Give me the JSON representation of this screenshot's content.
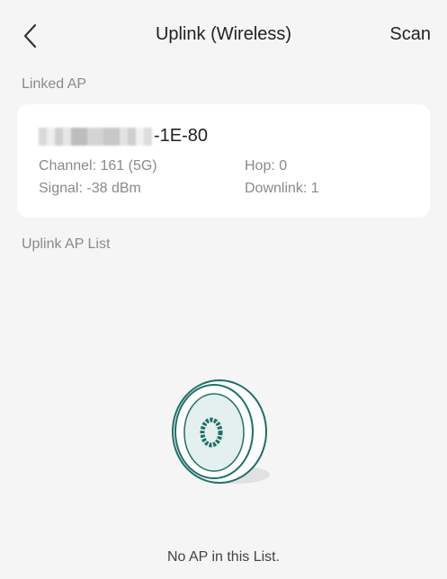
{
  "header": {
    "title": "Uplink (Wireless)",
    "scan_label": "Scan",
    "back_icon": "chevron-left-icon"
  },
  "linked_ap": {
    "section_label": "Linked AP",
    "name_suffix": "-1E-80",
    "channel": "Channel: 161 (5G)",
    "hop": "Hop: 0",
    "signal": "Signal: -38 dBm",
    "downlink": "Downlink: 1"
  },
  "uplink_list": {
    "section_label": "Uplink AP List",
    "empty_text": "No AP in this List.",
    "empty_icon": "access-point-device-icon"
  },
  "colors": {
    "background": "#f5f5f5",
    "card": "#ffffff",
    "accent_teal": "#1e6f68",
    "secondary_text": "#8a8a8a"
  }
}
